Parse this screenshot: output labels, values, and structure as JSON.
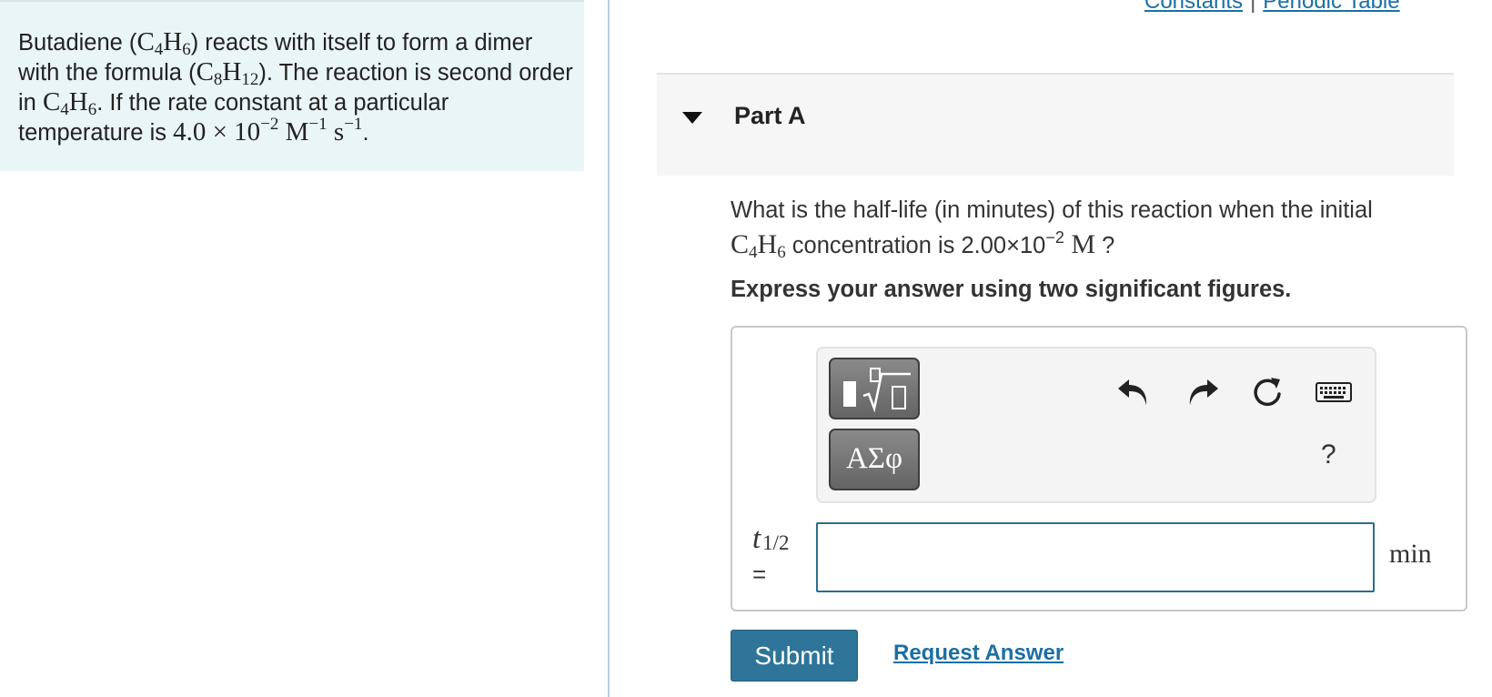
{
  "links": {
    "constants": "Constants",
    "separator": "|",
    "periodic_table": "Periodic Table"
  },
  "problem": {
    "t1": "Butadiene (",
    "f1_el1": "C",
    "f1_n1": "4",
    "f1_el2": "H",
    "f1_n2": "6",
    "t2": ") reacts with itself to form a dimer with the formula (",
    "f2_el1": "C",
    "f2_n1": "8",
    "f2_el2": "H",
    "f2_n2": "12",
    "t3": "). The reaction is second order in ",
    "f3_el1": "C",
    "f3_n1": "4",
    "f3_el2": "H",
    "f3_n2": "6",
    "t4": ". If the rate constant at a particular temperature is ",
    "k_mant": "4.0 × 10",
    "k_exp": "−2",
    "k_u1": " M",
    "k_u1_exp": "−1",
    "k_u2": " s",
    "k_u2_exp": "−1",
    "t5": "."
  },
  "part": {
    "label": "Part A"
  },
  "question": {
    "q1": "What is the half-life (in minutes) of this reaction when the initial",
    "f_el1": "C",
    "f_n1": "4",
    "f_el2": "H",
    "f_n2": "6",
    "q2": " concentration is 2.00×10",
    "q_exp": "−2",
    "q_unit": " M",
    "q3": " ?",
    "instruction": "Express your answer using two significant figures."
  },
  "toolbar": {
    "greek_label": "ΑΣφ",
    "help_label": "?",
    "icons": [
      "templates-icon",
      "greek-letters-icon",
      "undo-icon",
      "redo-icon",
      "reset-icon",
      "keyboard-icon",
      "help-icon"
    ]
  },
  "answer": {
    "variable": "t",
    "subscript": "1/2",
    "equals": "=",
    "value": "",
    "unit": "min"
  },
  "actions": {
    "submit_label": "Submit",
    "request_label": "Request Answer"
  },
  "colors": {
    "panel_bg": "#eaf5f7",
    "link": "#1b6fa3",
    "submit_bg": "#2e7599",
    "input_border": "#2c6d8e"
  }
}
